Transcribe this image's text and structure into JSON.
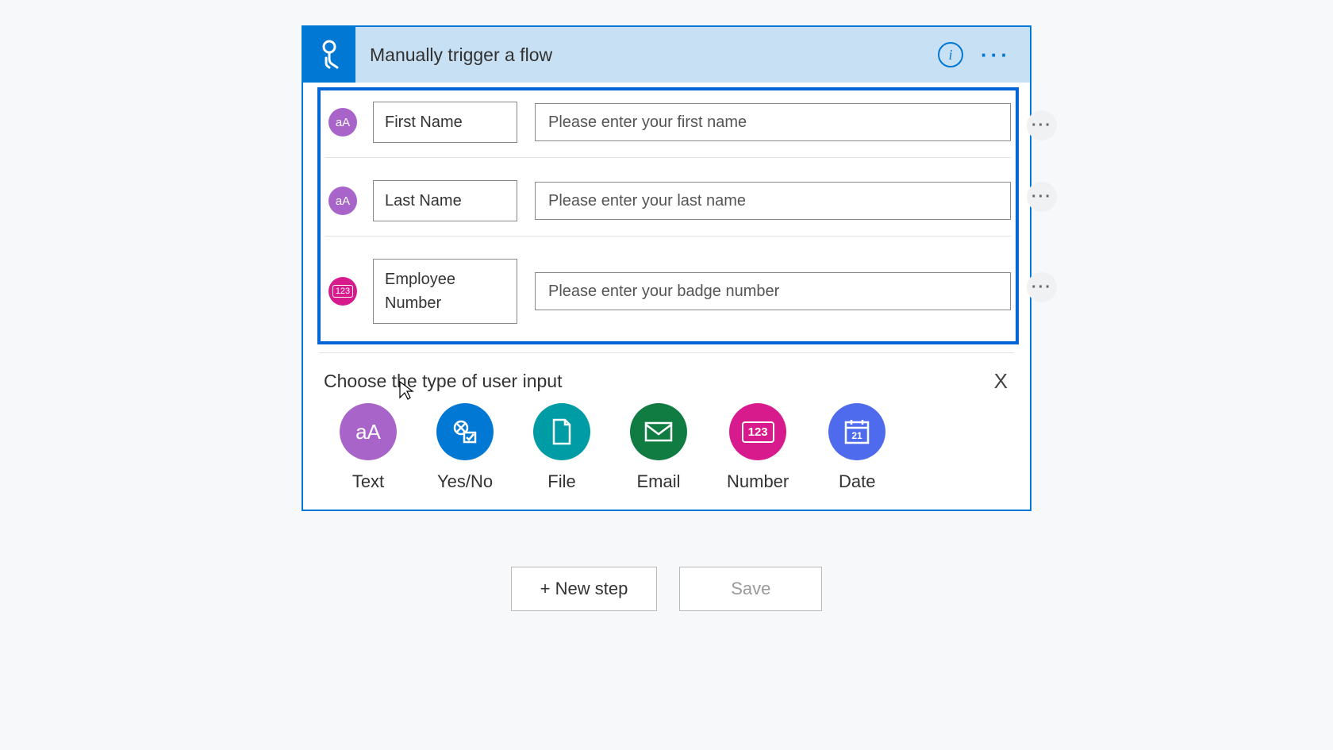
{
  "header": {
    "title": "Manually trigger a flow"
  },
  "inputs": [
    {
      "type": "text",
      "name": "First Name",
      "placeholder": "Please enter your first name"
    },
    {
      "type": "text",
      "name": "Last Name",
      "placeholder": "Please enter your last name"
    },
    {
      "type": "number",
      "name": "Employee Number",
      "placeholder": "Please enter your badge number"
    }
  ],
  "chooser": {
    "title": "Choose the type of user input",
    "close": "X",
    "options": [
      {
        "key": "text",
        "label": "Text"
      },
      {
        "key": "yesno",
        "label": "Yes/No"
      },
      {
        "key": "file",
        "label": "File"
      },
      {
        "key": "email",
        "label": "Email"
      },
      {
        "key": "number",
        "label": "Number"
      },
      {
        "key": "date",
        "label": "Date"
      }
    ]
  },
  "footer": {
    "new_step": "+ New step",
    "save": "Save"
  }
}
